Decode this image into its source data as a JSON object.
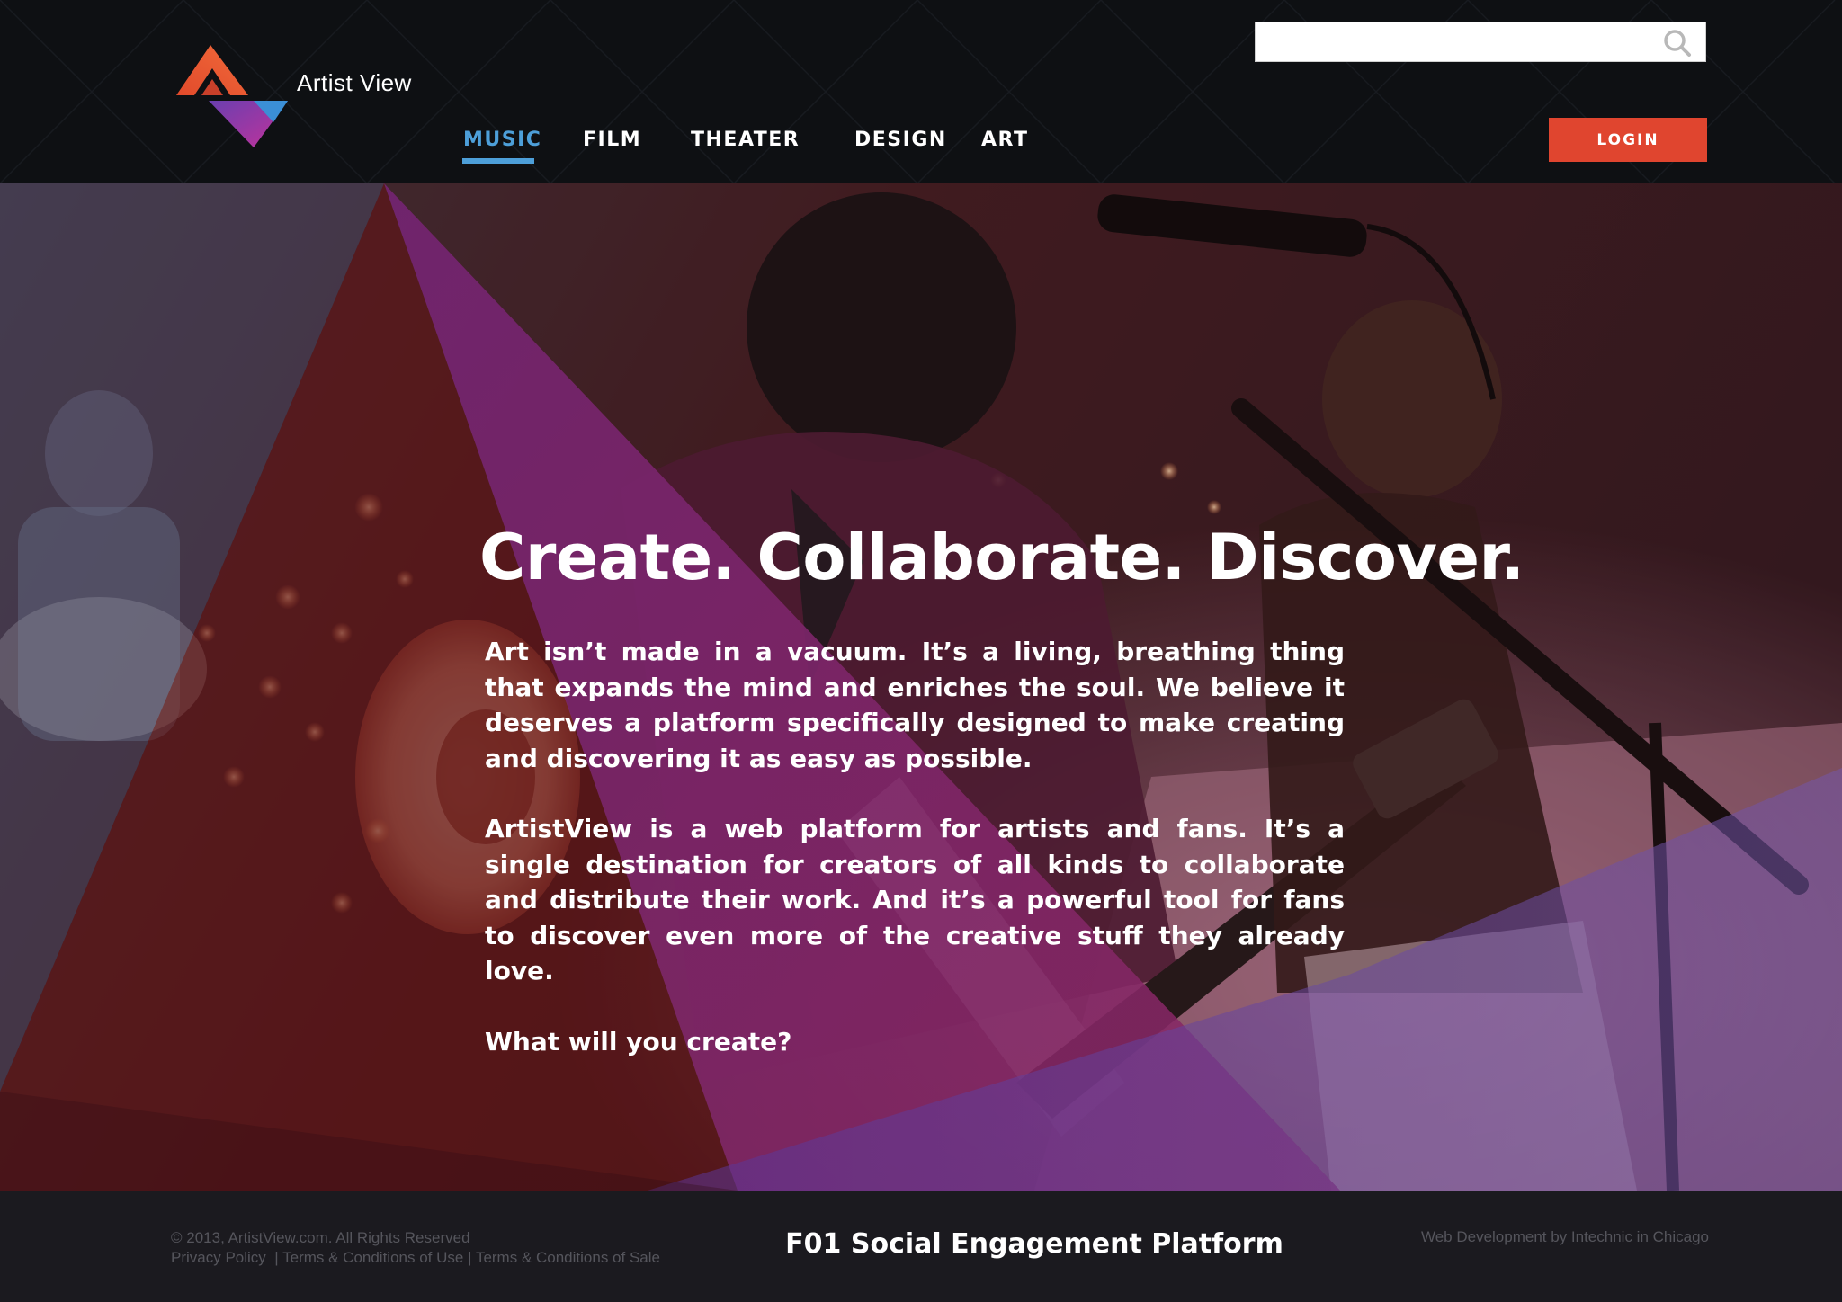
{
  "header": {
    "brand": "Artist View",
    "search": {
      "value": "",
      "placeholder": ""
    },
    "nav": [
      {
        "label": "MUSIC",
        "active": true
      },
      {
        "label": "FILM",
        "active": false
      },
      {
        "label": "THEATER",
        "active": false
      },
      {
        "label": "DESIGN",
        "active": false
      },
      {
        "label": "ART",
        "active": false
      }
    ],
    "login_label": "LOGIN"
  },
  "hero": {
    "title": "Create. Collaborate. Discover.",
    "paragraph_1": "Art isn’t made in a vacuum. It’s a living, breathing thing that expands the mind and enriches the soul. We believe it deserves a platform specifically designed to make creating and discovering it as easy as possible.",
    "paragraph_2": "ArtistView is a web platform for artists and fans. It’s a single destination for creators of all kinds to collaborate and distribute their work. And it’s a powerful tool for fans to discover even more of the creative stuff they already love.",
    "cta": "What will you create?"
  },
  "footer": {
    "copyright": "© 2013, ArtistView.com. All Rights Reserved",
    "links": [
      "Privacy Policy",
      "Terms & Conditions of Use",
      "Terms & Conditions of Sale"
    ],
    "separator": "|",
    "center_title": "F01 Social Engagement Platform",
    "credit": "Web Development by Intechnic in Chicago"
  },
  "icons": {
    "search": "search-icon",
    "logo": "artist-view-logo-icon"
  },
  "colors": {
    "header_bg": "#0e1013",
    "accent_blue": "#4d9fd9",
    "login_red": "#e0452f",
    "footer_bg": "#1b1a1f",
    "logo_orange": "#e1512e",
    "logo_purple": "#9b3fae",
    "logo_blue": "#3b8fd6"
  }
}
